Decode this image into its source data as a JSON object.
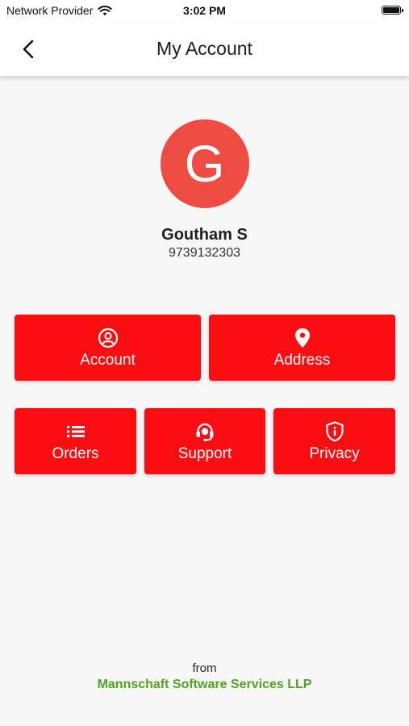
{
  "status_bar": {
    "carrier": "Network Provider",
    "time": "3:02 PM",
    "wifi_icon": "wifi-icon",
    "battery_icon": "battery-icon"
  },
  "nav": {
    "title": "My Account",
    "back_icon": "chevron-left-icon"
  },
  "profile": {
    "initial": "G",
    "name": "Goutham S",
    "phone": "9739132303",
    "avatar_color": "#ee4b42"
  },
  "tiles": [
    {
      "label": "Account",
      "icon": "user-circle-icon"
    },
    {
      "label": "Address",
      "icon": "location-pin-icon"
    },
    {
      "label": "Orders",
      "icon": "list-icon"
    },
    {
      "label": "Support",
      "icon": "headset-icon"
    },
    {
      "label": "Privacy",
      "icon": "shield-info-icon"
    }
  ],
  "footer": {
    "from": "from",
    "company": "Mannschaft Software Services LLP",
    "company_color": "#4fa31e"
  },
  "colors": {
    "accent": "#fb0d12",
    "background": "#f7f7f7"
  }
}
